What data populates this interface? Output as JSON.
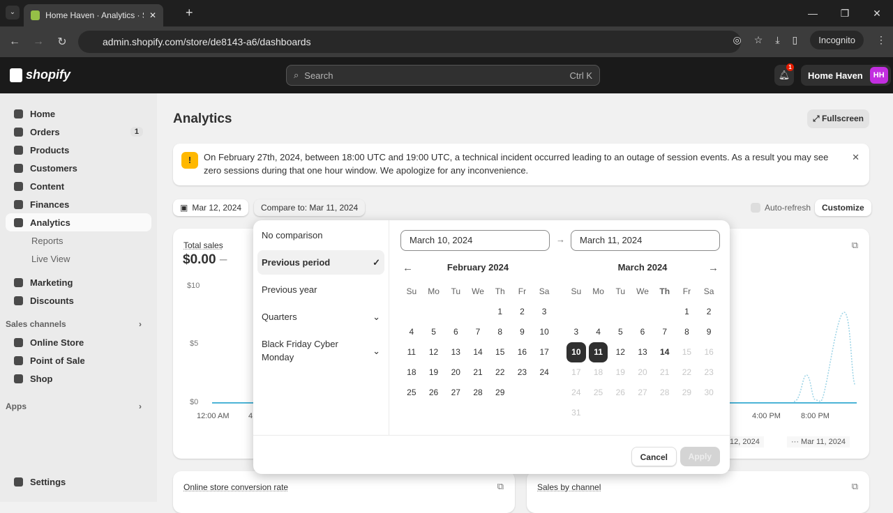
{
  "browser": {
    "tab_title": "Home Haven · Analytics · Shopify",
    "url": "admin.shopify.com/store/de8143-a6/dashboards",
    "profile": "Incognito"
  },
  "topbar": {
    "logo": "shopify",
    "search_placeholder": "Search",
    "search_shortcut": "Ctrl K",
    "notification_count": "1",
    "store_name": "Home Haven",
    "avatar": "HH"
  },
  "sidebar": {
    "items": [
      {
        "label": "Home"
      },
      {
        "label": "Orders",
        "count": "1"
      },
      {
        "label": "Products"
      },
      {
        "label": "Customers"
      },
      {
        "label": "Content"
      },
      {
        "label": "Finances"
      },
      {
        "label": "Analytics"
      }
    ],
    "sub": [
      {
        "label": "Reports"
      },
      {
        "label": "Live View"
      }
    ],
    "items2": [
      {
        "label": "Marketing"
      },
      {
        "label": "Discounts"
      }
    ],
    "sales_channels": "Sales channels",
    "channels": [
      {
        "label": "Online Store"
      },
      {
        "label": "Point of Sale"
      },
      {
        "label": "Shop"
      }
    ],
    "apps": "Apps",
    "settings": "Settings"
  },
  "main": {
    "title": "Analytics",
    "fullscreen": "Fullscreen",
    "banner": "On February 27th, 2024, between 18:00 UTC and 19:00 UTC, a technical incident occurred leading to an outage of session events. As a result you may see zero sessions during that one hour window. We apologize for any inconvenience.",
    "date": "Mar 12, 2024",
    "compare": "Compare to: Mar 11, 2024",
    "auto_refresh": "Auto-refresh",
    "customize": "Customize",
    "total_sales": {
      "label": "Total sales",
      "value": "$0.00",
      "dash": "–",
      "y_ticks": [
        "$10",
        "$5",
        "$0"
      ],
      "x_ticks": [
        "12:00 AM",
        "4",
        "4:00 PM",
        "8:00 PM"
      ],
      "legend": [
        "Mar 12, 2024",
        "Mar 11, 2024"
      ]
    },
    "conversion": "Online store conversion rate",
    "sales_by_channel": "Sales by channel"
  },
  "picker": {
    "options": [
      {
        "label": "No comparison"
      },
      {
        "label": "Previous period",
        "selected": true
      },
      {
        "label": "Previous year"
      },
      {
        "label": "Quarters"
      },
      {
        "label": "Black Friday Cyber Monday"
      }
    ],
    "start": "March 10, 2024",
    "end": "March 11, 2024",
    "weekdays": [
      "Su",
      "Mo",
      "Tu",
      "We",
      "Th",
      "Fr",
      "Sa"
    ],
    "months": [
      {
        "title": "February 2024",
        "offset": 4,
        "days": 29,
        "disabled_from": null
      },
      {
        "title": "March 2024",
        "offset": 5,
        "days": 31,
        "disabled_from": 15
      }
    ],
    "selected": [
      10,
      11
    ],
    "today": 14,
    "cancel": "Cancel",
    "apply": "Apply"
  },
  "colors": {
    "accent": "#303030",
    "line": "#4bb3d6"
  }
}
